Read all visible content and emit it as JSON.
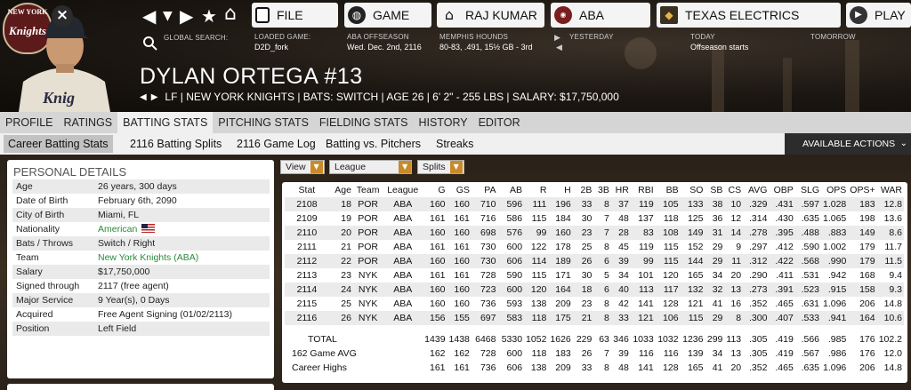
{
  "team_logo": {
    "top_text": "NEW YORK",
    "script_text": "Knights"
  },
  "close_icon": "×",
  "nav": {
    "back": "◀",
    "forward": "▶",
    "dropdown": "▼",
    "star": "★",
    "home": "⌂"
  },
  "search_label": "GLOBAL SEARCH:",
  "buttons": {
    "file": {
      "label": "FILE",
      "icon": "file-icon"
    },
    "game": {
      "label": "GAME",
      "icon": "globe-icon"
    },
    "manager": {
      "label": "RAJ KUMAR",
      "icon": "house-icon"
    },
    "league": {
      "label": "ABA",
      "icon": "league-logo-icon"
    },
    "team": {
      "label": "TEXAS ELECTRICS",
      "icon": "team-logo-icon"
    },
    "play": {
      "label": "PLAY",
      "icon": "play-icon"
    }
  },
  "subinfo": {
    "loaded_game_label": "LOADED GAME:",
    "loaded_game_value": "D2D_fork",
    "phase_label": "ABA OFFSEASON",
    "phase_value": "Wed. Dec. 2nd, 2116",
    "hounds_label": "MEMPHIS HOUNDS",
    "hounds_value": "80-83, .491, 15½ GB - 3rd",
    "yesterday_label": "YESTERDAY",
    "today_label": "TODAY",
    "today_value": "Offseason starts",
    "tomorrow_label": "TOMORROW"
  },
  "player": {
    "name": "DYLAN ORTEGA  #13",
    "line": "LF | NEW YORK KNIGHTS | BATS: SWITCH | AGE 26 | 6' 2\" - 255 LBS | SALARY: $17,750,000"
  },
  "tabs": [
    "PROFILE",
    "RATINGS",
    "BATTING STATS",
    "PITCHING STATS",
    "FIELDING STATS",
    "HISTORY",
    "EDITOR"
  ],
  "active_tab": "BATTING STATS",
  "subtabs": [
    "Career Batting Stats",
    "2116 Batting Splits",
    "2116 Game Log",
    "Batting vs. Pitchers",
    "Streaks"
  ],
  "actions_label": "AVAILABLE ACTIONS",
  "personal": {
    "title": "PERSONAL DETAILS",
    "rows": [
      {
        "k": "Age",
        "v": "26 years, 300 days"
      },
      {
        "k": "Date of Birth",
        "v": "February 6th, 2090"
      },
      {
        "k": "City of Birth",
        "v": "Miami, FL"
      },
      {
        "k": "Nationality",
        "v": "American"
      },
      {
        "k": "Bats / Throws",
        "v": "Switch / Right"
      },
      {
        "k": "Team",
        "v": "New York Knights (ABA)"
      },
      {
        "k": "Salary",
        "v": "$17,750,000"
      },
      {
        "k": "Signed through",
        "v": "2117 (free agent)"
      },
      {
        "k": "Major Service",
        "v": "9 Year(s), 0 Days"
      },
      {
        "k": "Acquired",
        "v": "Free Agent Signing (01/02/2113)"
      },
      {
        "k": "Position",
        "v": "Left Field"
      }
    ]
  },
  "filters": {
    "view": "View",
    "scope": "League Scope",
    "splits": "Splits"
  },
  "stats": {
    "headers": [
      "Stat",
      "Age",
      "Team",
      "League",
      "G",
      "GS",
      "PA",
      "AB",
      "R",
      "H",
      "2B",
      "3B",
      "HR",
      "RBI",
      "BB",
      "SO",
      "SB",
      "CS",
      "AVG",
      "OBP",
      "SLG",
      "OPS",
      "OPS+",
      "WAR"
    ],
    "rows": [
      [
        "2108",
        "18",
        "POR",
        "ABA",
        "160",
        "160",
        "710",
        "596",
        "111",
        "196",
        "33",
        "8",
        "37",
        "119",
        "105",
        "133",
        "38",
        "10",
        ".329",
        ".431",
        ".597",
        "1.028",
        "183",
        "12.8"
      ],
      [
        "2109",
        "19",
        "POR",
        "ABA",
        "161",
        "161",
        "716",
        "586",
        "115",
        "184",
        "30",
        "7",
        "48",
        "137",
        "118",
        "125",
        "36",
        "12",
        ".314",
        ".430",
        ".635",
        "1.065",
        "198",
        "13.6"
      ],
      [
        "2110",
        "20",
        "POR",
        "ABA",
        "160",
        "160",
        "698",
        "576",
        "99",
        "160",
        "23",
        "7",
        "28",
        "83",
        "108",
        "149",
        "31",
        "14",
        ".278",
        ".395",
        ".488",
        ".883",
        "149",
        "8.6"
      ],
      [
        "2111",
        "21",
        "POR",
        "ABA",
        "161",
        "161",
        "730",
        "600",
        "122",
        "178",
        "25",
        "8",
        "45",
        "119",
        "115",
        "152",
        "29",
        "9",
        ".297",
        ".412",
        ".590",
        "1.002",
        "179",
        "11.7"
      ],
      [
        "2112",
        "22",
        "POR",
        "ABA",
        "160",
        "160",
        "730",
        "606",
        "114",
        "189",
        "26",
        "6",
        "39",
        "99",
        "115",
        "144",
        "29",
        "11",
        ".312",
        ".422",
        ".568",
        ".990",
        "179",
        "11.5"
      ],
      [
        "2113",
        "23",
        "NYK",
        "ABA",
        "161",
        "161",
        "728",
        "590",
        "115",
        "171",
        "30",
        "5",
        "34",
        "101",
        "120",
        "165",
        "34",
        "20",
        ".290",
        ".411",
        ".531",
        ".942",
        "168",
        "9.4"
      ],
      [
        "2114",
        "24",
        "NYK",
        "ABA",
        "160",
        "160",
        "723",
        "600",
        "120",
        "164",
        "18",
        "6",
        "40",
        "113",
        "117",
        "132",
        "32",
        "13",
        ".273",
        ".391",
        ".523",
        ".915",
        "158",
        "9.3"
      ],
      [
        "2115",
        "25",
        "NYK",
        "ABA",
        "160",
        "160",
        "736",
        "593",
        "138",
        "209",
        "23",
        "8",
        "42",
        "141",
        "128",
        "121",
        "41",
        "16",
        ".352",
        ".465",
        ".631",
        "1.096",
        "206",
        "14.8"
      ],
      [
        "2116",
        "26",
        "NYK",
        "ABA",
        "156",
        "155",
        "697",
        "583",
        "118",
        "175",
        "21",
        "8",
        "33",
        "121",
        "106",
        "115",
        "29",
        "8",
        ".300",
        ".407",
        ".533",
        ".941",
        "164",
        "10.6"
      ]
    ],
    "summary": [
      [
        "TOTAL",
        "",
        "",
        "",
        "1439",
        "1438",
        "6468",
        "5330",
        "1052",
        "1626",
        "229",
        "63",
        "346",
        "1033",
        "1032",
        "1236",
        "299",
        "113",
        ".305",
        ".419",
        ".566",
        ".985",
        "176",
        "102.2"
      ],
      [
        "162 Game AVG",
        "",
        "",
        "",
        "162",
        "162",
        "728",
        "600",
        "118",
        "183",
        "26",
        "7",
        "39",
        "116",
        "116",
        "139",
        "34",
        "13",
        ".305",
        ".419",
        ".567",
        ".986",
        "176",
        "12.0"
      ],
      [
        "Career Highs",
        "",
        "",
        "",
        "161",
        "161",
        "736",
        "606",
        "138",
        "209",
        "33",
        "8",
        "48",
        "141",
        "128",
        "165",
        "41",
        "20",
        ".352",
        ".465",
        ".635",
        "1.096",
        "206",
        "14.8"
      ]
    ]
  }
}
